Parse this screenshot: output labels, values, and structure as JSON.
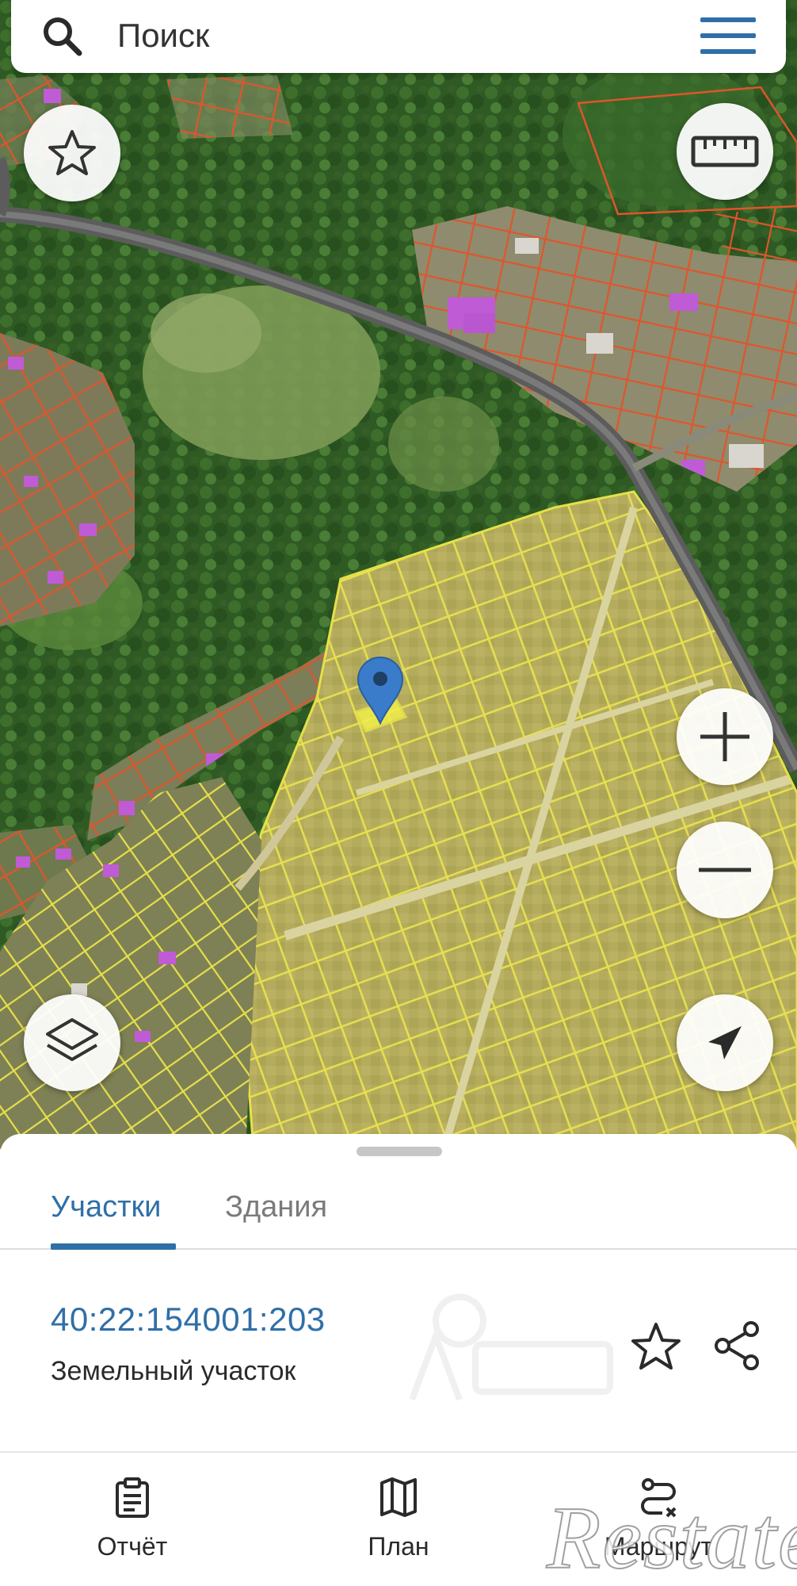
{
  "search": {
    "placeholder": "Поиск"
  },
  "tabs": [
    {
      "label": "Участки",
      "active": true
    },
    {
      "label": "Здания",
      "active": false
    }
  ],
  "parcel": {
    "cadastral_number": "40:22:154001:203",
    "type": "Земельный участок"
  },
  "bottom_nav": [
    {
      "label": "Отчёт",
      "icon": "clipboard-icon"
    },
    {
      "label": "План",
      "icon": "map-icon"
    },
    {
      "label": "Маршрут",
      "icon": "route-icon"
    }
  ],
  "map_controls": [
    "star-icon",
    "ruler-icon",
    "zoom-in-icon",
    "zoom-out-icon",
    "layers-icon",
    "locate-icon"
  ],
  "watermark": "Restate",
  "colors": {
    "accent": "#2f6fa8",
    "parcel_border_red": "#e0552b",
    "parcel_border_yellow": "#e6e04a",
    "selected_parcel_fill": "#f2ef4a",
    "marker": "#3a7cc9",
    "building_highlight": "#c05bd6"
  }
}
